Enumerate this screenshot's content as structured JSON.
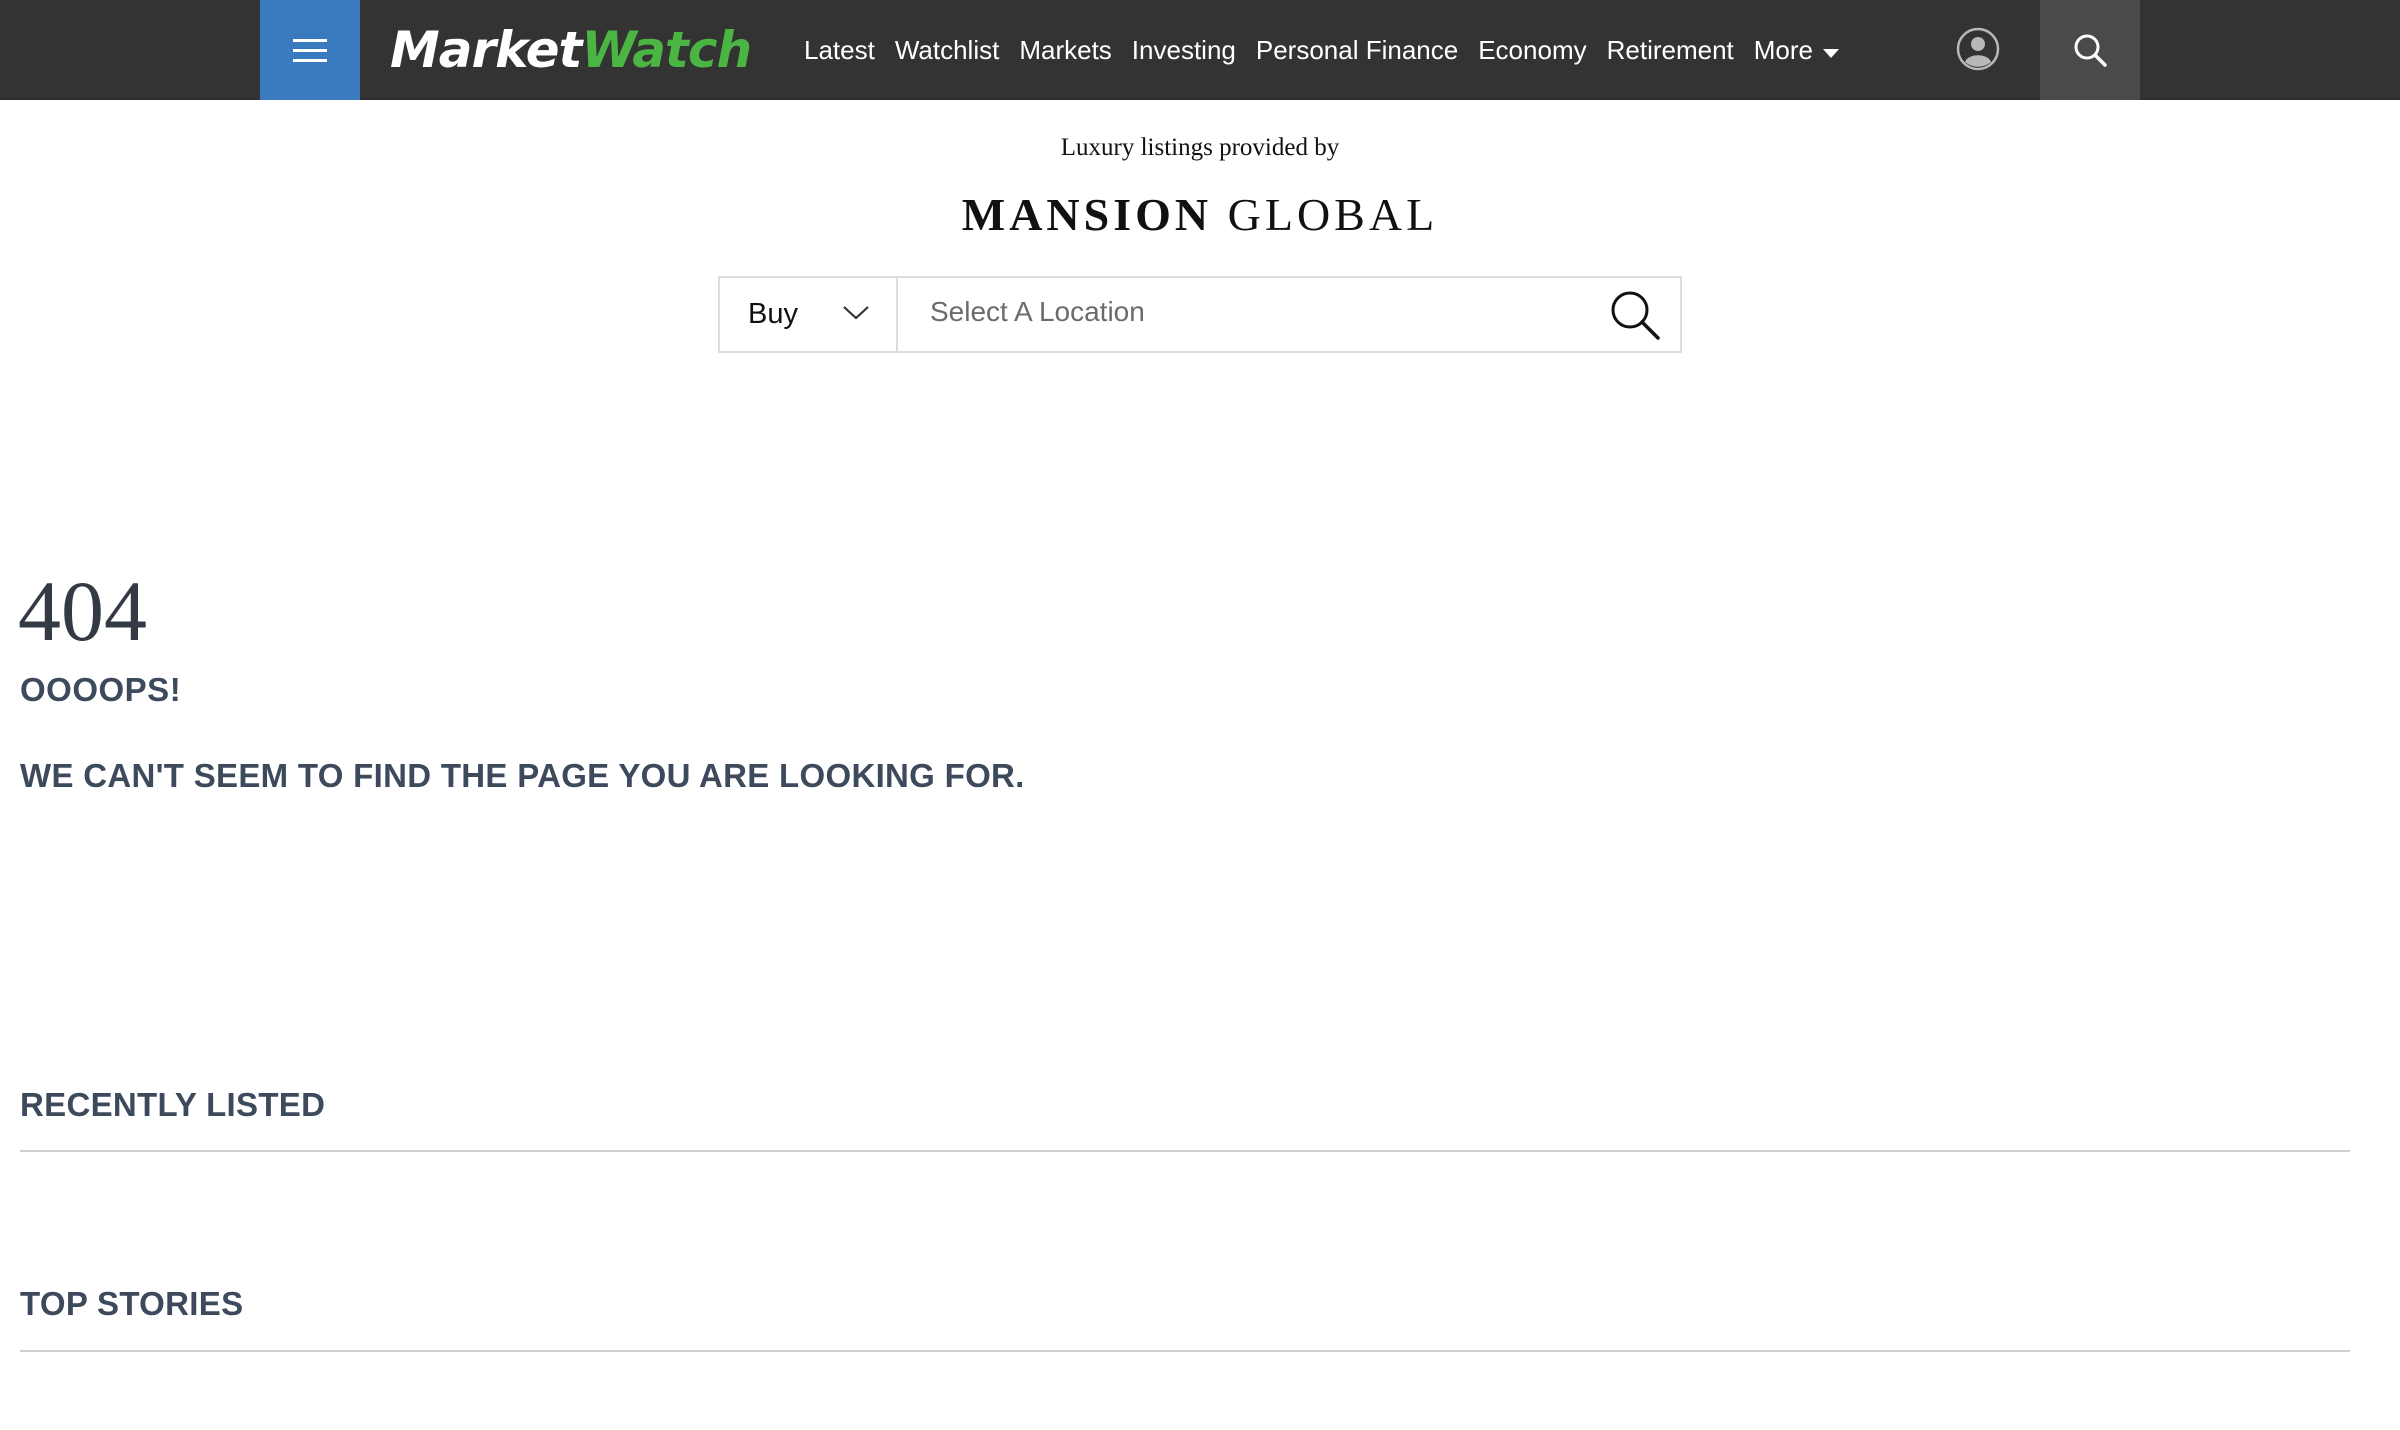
{
  "header": {
    "logo_part1": "Market",
    "logo_part2": "Watch",
    "nav": [
      "Latest",
      "Watchlist",
      "Markets",
      "Investing",
      "Personal Finance",
      "Economy",
      "Retirement"
    ],
    "more_label": "More",
    "colors": {
      "bar": "#333333",
      "menu_button": "#3a7bbf",
      "logo_accent": "#4bb543"
    },
    "icons": {
      "menu": "hamburger-icon",
      "user": "user-icon",
      "search": "search-icon"
    }
  },
  "mansion": {
    "provided_by": "Luxury listings provided by",
    "logo_bold": "MANSION",
    "logo_light": "GLOBAL",
    "select_value": "Buy",
    "location_placeholder": "Select A Location"
  },
  "error": {
    "code": "404",
    "oops": "OOOOPS!",
    "message": "WE CAN'T SEEM TO FIND THE PAGE YOU ARE LOOKING FOR."
  },
  "sections": {
    "recently_listed": "RECENTLY LISTED",
    "top_stories": "TOP STORIES"
  }
}
